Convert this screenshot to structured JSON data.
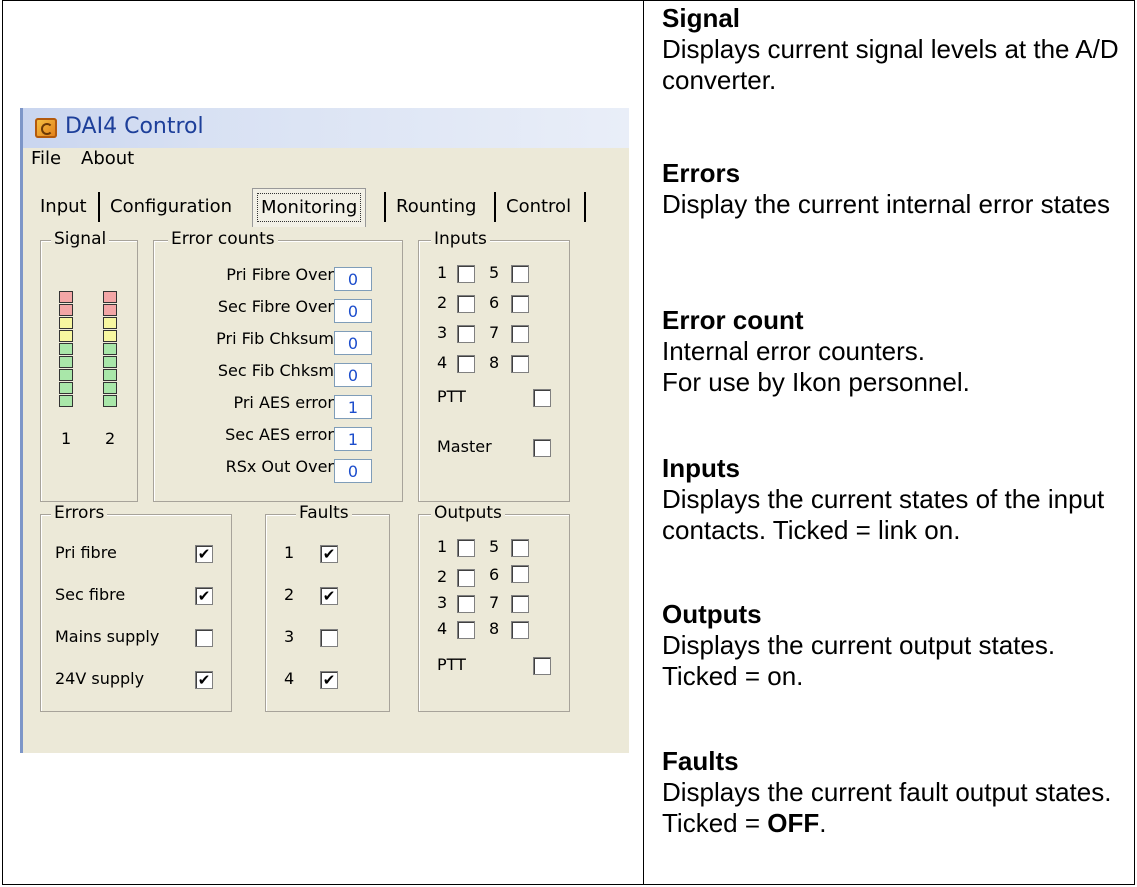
{
  "window": {
    "title": "DAI4 Control",
    "menu": [
      "File",
      "About"
    ],
    "tabs": [
      "Input",
      "Configuration",
      "Monitoring",
      "Rounting",
      "Control"
    ],
    "active_tab": "Monitoring"
  },
  "signal": {
    "label": "Signal",
    "channels": [
      "1",
      "2"
    ]
  },
  "error_counts": {
    "label": "Error counts",
    "rows": [
      {
        "label": "Pri Fibre Over",
        "value": "0"
      },
      {
        "label": "Sec Fibre Over",
        "value": "0"
      },
      {
        "label": "Pri Fib Chksum",
        "value": "0"
      },
      {
        "label": "Sec Fib Chksm",
        "value": "0"
      },
      {
        "label": "Pri AES error",
        "value": "1"
      },
      {
        "label": "Sec AES error",
        "value": "1"
      },
      {
        "label": "RSx Out Over",
        "value": "0"
      }
    ]
  },
  "inputs": {
    "label": "Inputs",
    "numbers": [
      "1",
      "2",
      "3",
      "4",
      "5",
      "6",
      "7",
      "8"
    ],
    "checked": [
      false,
      false,
      false,
      false,
      false,
      false,
      false,
      false
    ],
    "ptt_label": "PTT",
    "ptt_checked": false,
    "master_label": "Master",
    "master_checked": false
  },
  "errors": {
    "label": "Errors",
    "rows": [
      {
        "label": "Pri fibre",
        "checked": true
      },
      {
        "label": "Sec fibre",
        "checked": true
      },
      {
        "label": "Mains supply",
        "checked": false
      },
      {
        "label": "24V supply",
        "checked": true
      }
    ]
  },
  "faults": {
    "label": "Faults",
    "rows": [
      {
        "label": "1",
        "checked": true
      },
      {
        "label": "2",
        "checked": true
      },
      {
        "label": "3",
        "checked": false
      },
      {
        "label": "4",
        "checked": true
      }
    ]
  },
  "outputs": {
    "label": "Outputs",
    "numbers": [
      "1",
      "2",
      "3",
      "4",
      "5",
      "6",
      "7",
      "8"
    ],
    "checked": [
      false,
      false,
      false,
      false,
      false,
      false,
      false,
      false
    ],
    "ptt_label": "PTT",
    "ptt_checked": false
  },
  "descriptions": [
    {
      "title": "Signal",
      "text": "Displays current signal levels at the A/D converter."
    },
    {
      "title": "Errors",
      "text": "Display the current internal error states"
    },
    {
      "title": "Error count",
      "text": "Internal error counters.\nFor use by Ikon personnel."
    },
    {
      "title": "Inputs",
      "text": "Displays the current states of the input contacts. Ticked = link on."
    },
    {
      "title": "Outputs",
      "text": "Displays the current output states. Ticked = on."
    },
    {
      "title": "Faults",
      "text_before": "Displays the current fault output states. Ticked = ",
      "text_bold": "OFF",
      "text_after": "."
    }
  ],
  "colors": {
    "value_text": "#1c4dcc",
    "title_text": "#1d3f9a",
    "window_bg": "#ece9d8"
  }
}
